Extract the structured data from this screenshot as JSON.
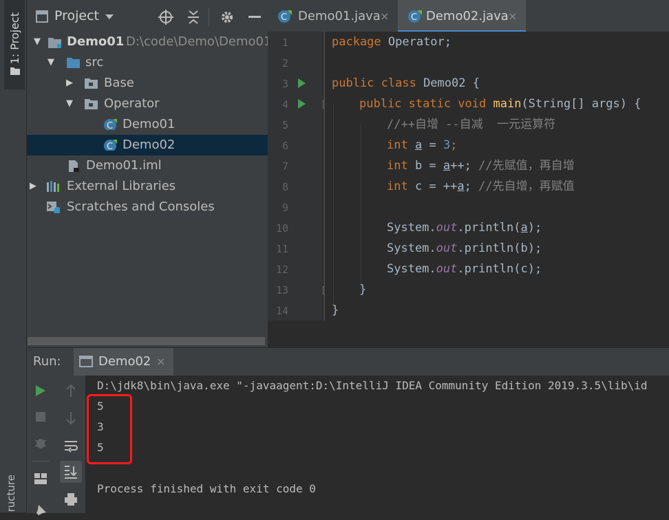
{
  "sidebar": {
    "project_tab": "1: Project",
    "structure_tab": "ructure"
  },
  "project_panel": {
    "title": "Project",
    "tree": [
      {
        "label": "Demo01",
        "path": "D:\\code\\Demo\\Demo01",
        "icon": "module-folder-icon"
      },
      {
        "label": "src",
        "icon": "source-folder-icon"
      },
      {
        "label": "Base",
        "icon": "package-icon"
      },
      {
        "label": "Operator",
        "icon": "package-icon"
      },
      {
        "label": "Demo01",
        "icon": "java-class-icon"
      },
      {
        "label": "Demo02",
        "icon": "java-class-icon"
      },
      {
        "label": "Demo01.iml",
        "icon": "iml-file-icon"
      },
      {
        "label": "External Libraries",
        "icon": "library-icon"
      },
      {
        "label": "Scratches and Consoles",
        "icon": "scratches-icon"
      }
    ]
  },
  "editor": {
    "tabs": [
      {
        "label": "Demo01.java",
        "close": "×"
      },
      {
        "label": "Demo02.java",
        "close": "×"
      }
    ],
    "line_numbers": [
      "1",
      "2",
      "3",
      "4",
      "5",
      "6",
      "7",
      "8",
      "9",
      "10",
      "11",
      "12",
      "13",
      "14"
    ],
    "code": {
      "l1_kw": "package",
      "l1_rest": " Operator;",
      "l3_kw": "public class",
      "l3_rest": " Demo02 {",
      "l4_kw": "public static void",
      "l4_fn": "main",
      "l4_rest": "(String[] args) {",
      "l5_cmt": "//++自增 --自减  一元运算符",
      "l6_kw": "int",
      "l6_var": "a",
      "l6_mid": " = ",
      "l6_num": "3",
      "l6_end": ";",
      "l7_kw": "int",
      "l7_mid": " b = ",
      "l7_var": "a",
      "l7_op": "++; ",
      "l7_cmt": "//先赋值，再自增",
      "l8_kw": "int",
      "l8_mid": " c = ++",
      "l8_var": "a",
      "l8_end": "; ",
      "l8_cmt": "//先自增，再赋值",
      "l10_pre": "System.",
      "l10_fld": "out",
      "l10_mid": ".println(",
      "l10_var": "a",
      "l10_end": ");",
      "l11_pre": "System.",
      "l11_fld": "out",
      "l11_rest": ".println(b);",
      "l12_pre": "System.",
      "l12_fld": "out",
      "l12_rest": ".println(c);",
      "l13": "}",
      "l14": "}"
    }
  },
  "run_panel": {
    "label": "Run:",
    "tab": "Demo02",
    "tab_close": "×",
    "console": {
      "command": "D:\\jdk8\\bin\\java.exe \"-javaagent:D:\\IntelliJ IDEA Community Edition 2019.3.5\\lib\\id",
      "outputs": [
        "5",
        "3",
        "5"
      ],
      "finish": "Process finished with exit code 0"
    }
  },
  "colors": {
    "background": "#2b2b2b",
    "panel": "#3c3f41",
    "keyword": "#cc7832",
    "function": "#ffc66d",
    "number": "#6897bb",
    "comment": "#808080",
    "field": "#9876aa",
    "run_green": "#499c54",
    "selection": "#0d293e",
    "highlight_box": "#ff1a1a"
  }
}
